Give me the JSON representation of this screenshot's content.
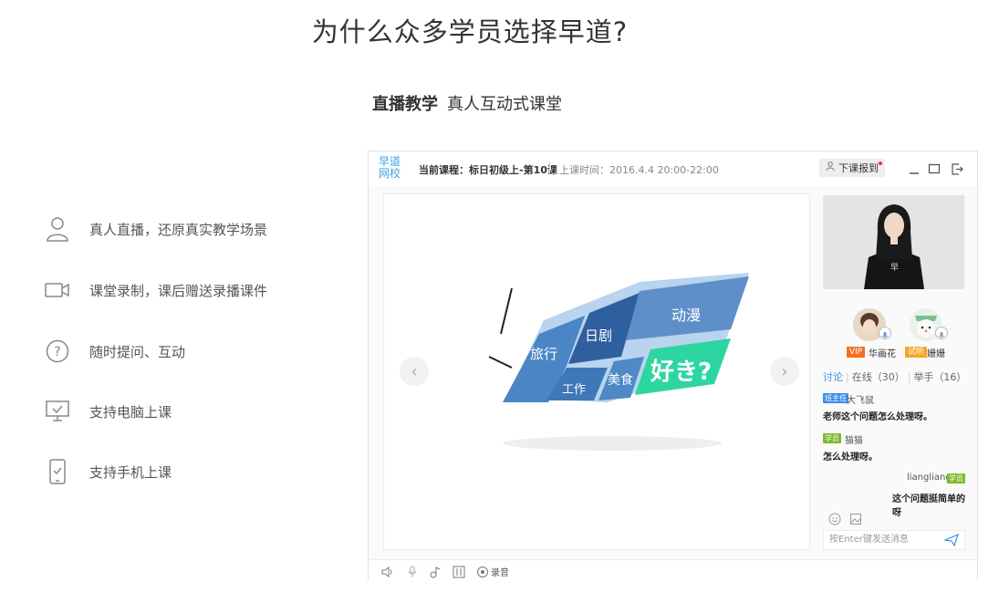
{
  "header": {
    "title": "为什么众多学员选择早道?",
    "subtitle_bold": "直播教学",
    "subtitle_rest": "真人互动式课堂"
  },
  "features": [
    {
      "icon": "user-icon",
      "label": "真人直播，还原真实教学场景"
    },
    {
      "icon": "video-camera-icon",
      "label": "课堂录制，课后赠送录播课件"
    },
    {
      "icon": "question-icon",
      "label": "随时提问、互动"
    },
    {
      "icon": "monitor-check-icon",
      "label": "支持电脑上课"
    },
    {
      "icon": "phone-check-icon",
      "label": "支持手机上课"
    }
  ],
  "classroom": {
    "logo_line1": "早道",
    "logo_line2": "网校",
    "course": "当前课程：标日初级上-第10课",
    "time": "上课时间：2016.4.4 20:00-22:00",
    "dismiss_button": "下课报到",
    "slide_words": [
      "旅行",
      "日剧",
      "动漫",
      "工作",
      "美食",
      "好き?"
    ],
    "participants": [
      {
        "badge": "VIP",
        "badge_color": "#f36f21",
        "name": "华画花"
      },
      {
        "badge": "试听",
        "badge_color": "#f5a623",
        "name": "姗姗"
      }
    ],
    "tabs": {
      "discuss": "讨论",
      "online": "在线（30）",
      "hands": "举手（16）"
    },
    "messages": [
      {
        "tag": "班主任",
        "tag_color": "#3a8ee6",
        "name": "大飞鼠",
        "text": "老师这个问题怎么处理呀。"
      },
      {
        "tag": "学员",
        "tag_color": "#7cb82f",
        "name": "猫猫",
        "text": "怎么处理呀。"
      },
      {
        "tag": "学员",
        "tag_color": "#7cb82f",
        "name": "liangliang",
        "text": "这个问题挺简单的呀"
      }
    ],
    "input_placeholder": "按Enter键发送消息",
    "record_label": "录音"
  },
  "colors": {
    "accent": "#3a8ee6",
    "slide_green": "#2dd6a0"
  }
}
